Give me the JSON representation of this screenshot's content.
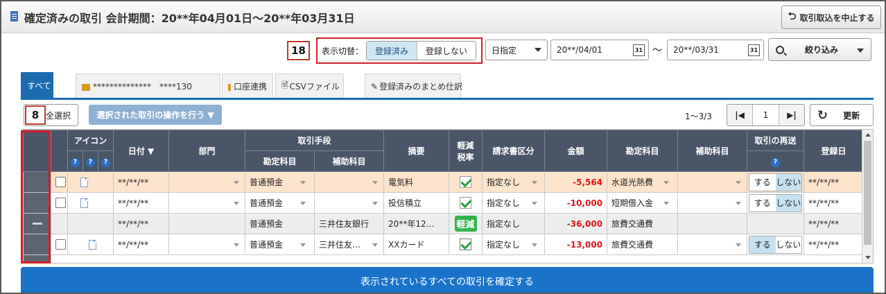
{
  "header": {
    "title": "確定済みの取引 会計期間：20**年04月01日〜20**年03月31日",
    "abort_label": "取引取込を中止する"
  },
  "annotations": {
    "box18": "18",
    "box8": "8"
  },
  "display_toggle": {
    "label": "表示切替：",
    "options": [
      "登録済み",
      "登録しない"
    ],
    "selected": "登録済み"
  },
  "date_filter": {
    "mode": "日指定",
    "from": "20**/04/01",
    "to": "20**/03/31",
    "separator": "〜",
    "calendar_icon_text": "31",
    "filter_label": "絞り込み"
  },
  "tabs": [
    {
      "label": "すべて",
      "active": true
    },
    {
      "label": "**************　****130",
      "active": false
    },
    {
      "label": "口座連携",
      "active": false
    },
    {
      "label": "CSVファイル",
      "active": false
    },
    {
      "label": "登録済みのまとめ仕訳",
      "active": false
    }
  ],
  "toolbar": {
    "select_all": "全選択",
    "ops_button": "選択された取引の操作を行う ▼",
    "page_count": "1〜3/3",
    "page_number": "1",
    "refresh": "更新"
  },
  "table": {
    "headers": {
      "icon": "アイコン",
      "date": "日付 ▼",
      "dept": "部門",
      "means": "取引手段",
      "means_account": "勘定科目",
      "means_sub": "補助科目",
      "summary": "摘要",
      "tax_line1": "軽減",
      "tax_line2": "税率",
      "invoice": "請求書区分",
      "amount": "金額",
      "account": "勘定科目",
      "sub_account": "補助科目",
      "resend": "取引の再送",
      "reg_date": "登録日",
      "help": "?"
    },
    "rows": [
      {
        "date": "**/**/**",
        "means_account": "普通預金",
        "means_sub": "",
        "summary": "電気料",
        "tax": "checkbox",
        "invoice": "指定なし",
        "amount": "-5,564",
        "account": "水道光熱費",
        "sub_account": "",
        "resend": "しない",
        "reg_date": "**/**/**"
      },
      {
        "date": "**/**/**",
        "means_account": "普通預金",
        "means_sub": "",
        "summary": "投信積立",
        "tax": "checkbox",
        "invoice": "指定なし",
        "amount": "-10,000",
        "account": "短期借入金",
        "sub_account": "",
        "resend": "しない",
        "reg_date": "**/**/**"
      },
      {
        "date": "**/**/**",
        "means_account": "普通預金",
        "means_sub": "三井住友銀行",
        "summary": "20**年12…",
        "tax": "軽減",
        "invoice": "指定なし",
        "amount": "-36,000",
        "account": "旅費交通費",
        "sub_account": "",
        "resend": "",
        "reg_date": "**/**/**"
      },
      {
        "date": "**/**/**",
        "means_account": "普通預金",
        "means_sub": "三井住友…",
        "summary": "XXカード",
        "tax": "checked",
        "invoice": "指定なし",
        "amount": "-13,000",
        "account": "旅費交通費",
        "sub_account": "",
        "resend": "する",
        "reg_date": "**/**/**"
      }
    ],
    "resend_options": [
      "する",
      "しない"
    ]
  },
  "confirm_button": "表示されているすべての取引を確定する",
  "colors": {
    "accent": "#1b6bb0",
    "header_bg": "#4a5568",
    "negative": "#e0161b",
    "highlight_row": "#fbe3cc",
    "annotation_red": "#d01f2b"
  }
}
